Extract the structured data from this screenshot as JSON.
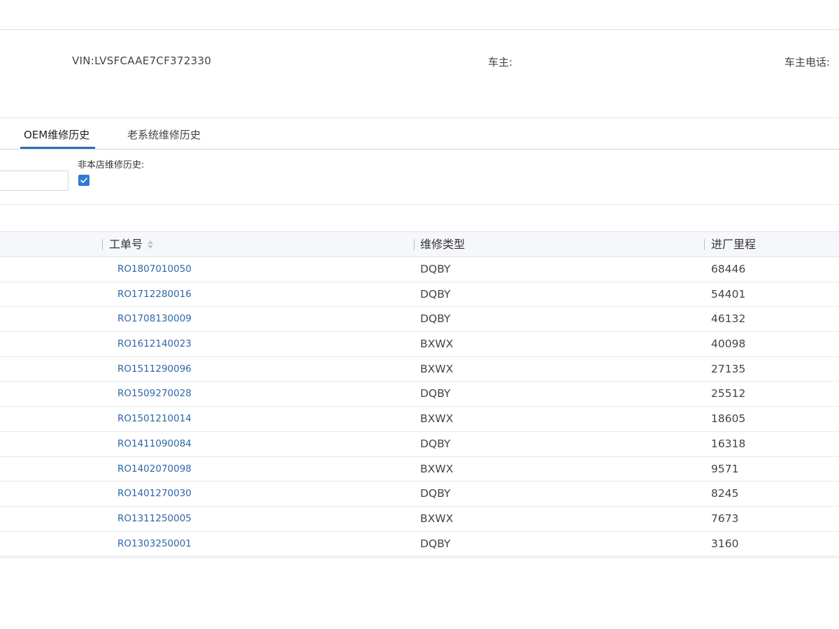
{
  "vehicle": {
    "vin_label": "VIN:",
    "vin_value": "LVSFCAAE7CF372330",
    "owner_label": "车主:",
    "owner_value": "",
    "phone_label": "车主电话:",
    "phone_value": ""
  },
  "tabs": [
    {
      "label": "OEM维修历史",
      "active": true
    },
    {
      "label": "老系统维修历史",
      "active": false
    }
  ],
  "filters": {
    "input_value": "",
    "non_store_history_label": "非本店维修历史:",
    "non_store_history_checked": true
  },
  "table": {
    "headers": {
      "ro_number": "工单号",
      "repair_type": "维修类型",
      "mileage": "进厂里程"
    },
    "rows": [
      {
        "ro": "RO1807010050",
        "type": "DQBY",
        "km": "68446"
      },
      {
        "ro": "RO1712280016",
        "type": "DQBY",
        "km": "54401"
      },
      {
        "ro": "RO1708130009",
        "type": "DQBY",
        "km": "46132"
      },
      {
        "ro": "RO1612140023",
        "type": "BXWX",
        "km": "40098"
      },
      {
        "ro": "RO1511290096",
        "type": "BXWX",
        "km": "27135"
      },
      {
        "ro": "RO1509270028",
        "type": "DQBY",
        "km": "25512"
      },
      {
        "ro": "RO1501210014",
        "type": "BXWX",
        "km": "18605"
      },
      {
        "ro": "RO1411090084",
        "type": "DQBY",
        "km": "16318"
      },
      {
        "ro": "RO1402070098",
        "type": "BXWX",
        "km": "9571"
      },
      {
        "ro": "RO1401270030",
        "type": "DQBY",
        "km": "8245"
      },
      {
        "ro": "RO1311250005",
        "type": "BXWX",
        "km": "7673"
      },
      {
        "ro": "RO1303250001",
        "type": "DQBY",
        "km": "3160"
      }
    ]
  },
  "colors": {
    "accent": "#2f6fb3",
    "link": "#2f66a8",
    "checkbox": "#2f7ad6",
    "header_bg": "#f5f7fa"
  }
}
